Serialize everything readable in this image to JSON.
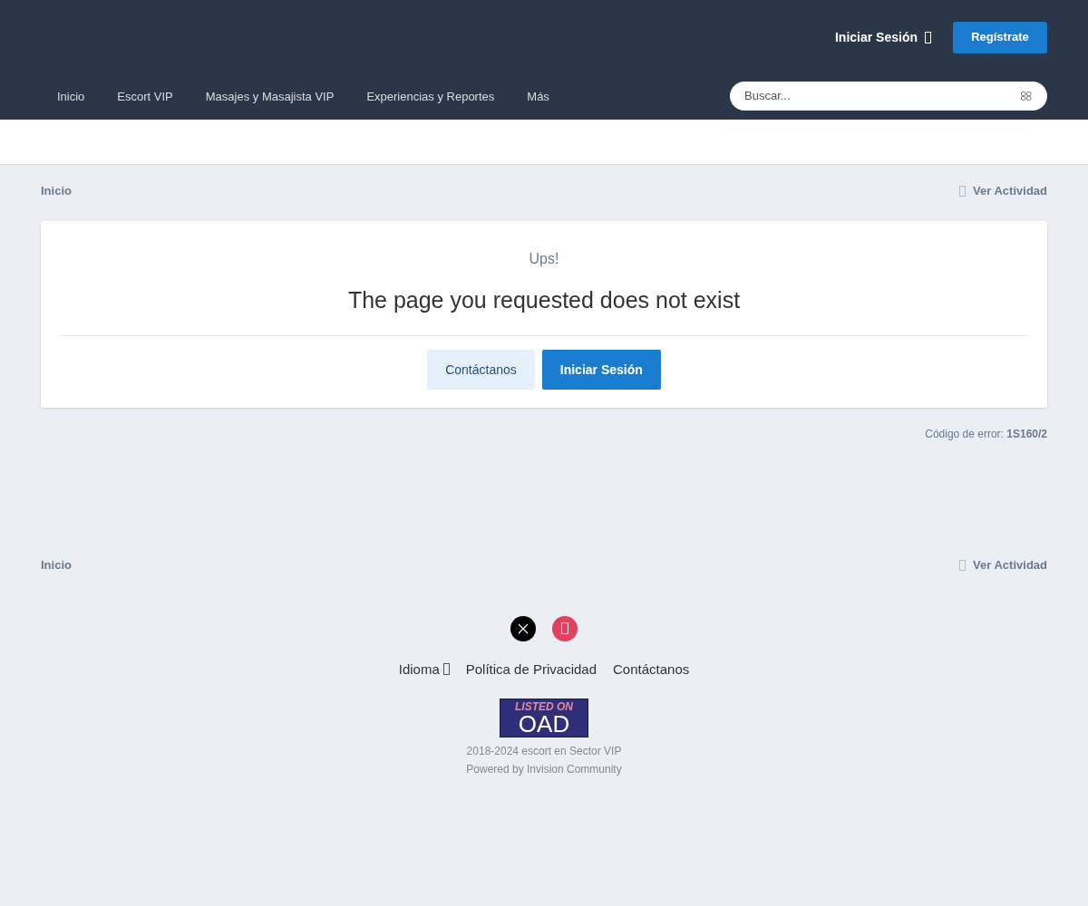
{
  "header": {
    "sign_in": "Iniciar Sesión",
    "register": "Regístrate"
  },
  "nav": {
    "items": [
      {
        "label": "Inicio",
        "selected": false
      },
      {
        "label": "Escort VIP",
        "selected": false
      },
      {
        "label": "Masajes y Masajista VIP",
        "selected": false
      },
      {
        "label": "Experiencias y Reportes",
        "selected": false
      },
      {
        "label": "Más",
        "selected": false
      }
    ],
    "search": {
      "placeholder": "Buscar..."
    }
  },
  "breadcrumb_top": {
    "home": "Inicio",
    "activity": "Ver Actividad"
  },
  "error_card": {
    "kicker": "Ups!",
    "message": "The page you requested does not exist",
    "buttons": [
      {
        "label": "Contáctanos",
        "kind": "secondary"
      },
      {
        "label": "Iniciar Sesión",
        "kind": "primary"
      }
    ]
  },
  "error_code": "Código de error: **1S160/2**",
  "breadcrumb_bottom": {
    "home": "Inicio",
    "activity": "Ver Actividad"
  },
  "footer": {
    "links": [
      {
        "label": "Idioma",
        "kind": "menu"
      },
      {
        "label": "Política de Privacidad",
        "kind": "link"
      },
      {
        "label": "Contáctanos",
        "kind": "link"
      }
    ],
    "badge": {
      "line1": "LISTED ON",
      "line2": "OAD"
    },
    "copyright": "2018-2024 escort en Sector VIP",
    "powered": "Powered by Invision Community"
  }
}
